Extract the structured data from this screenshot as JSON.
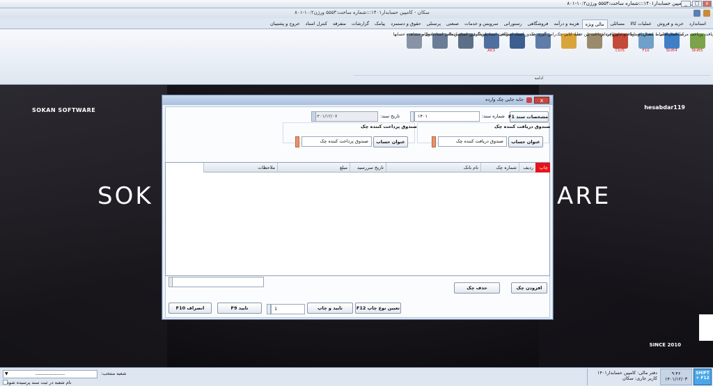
{
  "window": {
    "title": "سکان - کامپین حسابدار۱۴۰۱:::شماره ساخت:۵۵۵۴   ورژن۱۰:۲-۸۰۱",
    "subtitle": "سکان - کامپین حسابدار۱۴۰۱:::شماره ساخت:۵۵۵۴   ورژن۱۰:۲-۸۰۱"
  },
  "tabs": [
    {
      "label": "استاندارد",
      "active": false
    },
    {
      "label": "خرید و فروش",
      "active": false
    },
    {
      "label": "عملیات کالا",
      "active": false
    },
    {
      "label": "مسائلی",
      "active": false
    },
    {
      "label": "مالی ویژه",
      "active": true
    },
    {
      "label": "هزینه و درآمد",
      "active": false
    },
    {
      "label": "فروشگاهی",
      "active": false
    },
    {
      "label": "رستورانی",
      "active": false
    },
    {
      "label": "سرویس و خدمات",
      "active": false
    },
    {
      "label": "صنعتی",
      "active": false
    },
    {
      "label": "پرسنلی",
      "active": false
    },
    {
      "label": "حقوق و دستمزد",
      "active": false
    },
    {
      "label": "پیامک",
      "active": false
    },
    {
      "label": "گزارشات",
      "active": false
    },
    {
      "label": "متفرقه",
      "active": false
    },
    {
      "label": "کنترل اسناد",
      "active": false
    },
    {
      "label": "خروج و پشتیبان",
      "active": false
    }
  ],
  "ribbon": {
    "group_label": "ادامه",
    "buttons": [
      {
        "label": "دریافت پرداخت مرکب",
        "hotkey": "Shift5",
        "icon": "payment-icon"
      },
      {
        "label": "مبادلات داخلی",
        "hotkey": "Shift4",
        "icon": "exchange-icon"
      },
      {
        "label": "اعمال اقساط مشتری و دریافت قسط",
        "hotkey": "F10",
        "icon": "installment-icon"
      },
      {
        "label": "اعمال اقساط خودمان و پرداخت قسط",
        "hotkey": "Ctrl5",
        "icon": "installment-pay-icon"
      },
      {
        "label": "دریافت پرداخت بین حسابها",
        "hotkey": "",
        "icon": "bank-icon"
      },
      {
        "label": "جابه جایی چک",
        "hotkey": "",
        "icon": "check-move-icon"
      },
      {
        "label": "راس گیری چک",
        "hotkey": "",
        "icon": "calculator-icon"
      },
      {
        "label": "صدور اسناد انتظامی",
        "hotkey": "",
        "icon": "officer-icon"
      },
      {
        "label": "دریافت اسناد انتظامی",
        "hotkey": "Alt3",
        "icon": "officer-receive-icon"
      },
      {
        "label": "پس گرفتن اسناد انتظامی",
        "hotkey": "",
        "icon": "officer-back-icon"
      },
      {
        "label": "پس دادن اسناد انتظامی",
        "hotkey": "",
        "icon": "officer-return-icon"
      },
      {
        "label": "جدول و مشاهده حسابها",
        "hotkey": "",
        "icon": "search-table-icon"
      }
    ]
  },
  "background": {
    "brand_left": "SOKAN SOFTWARE",
    "brand_right": "hesabdar119",
    "big_left": "SOK",
    "big_right": "ARE",
    "since": "SINCE 2010"
  },
  "dialog": {
    "title": "جابه جایی چک وارده",
    "close": "x",
    "doc_spec_button": "مشخصات سند F1",
    "doc_number_label": "شماره سند:",
    "doc_number": "۱۴۰۱",
    "doc_date_label": "تاریخ سند:",
    "doc_date": "۱۴۰۱/۱۲/۰۷",
    "receiver_group": "صندوق دریافت کننده چک",
    "receiver_button": "عنوان حساب",
    "receiver_value": "صندوق دریافت کننده چک",
    "payer_group": "صندوق پرداخت کننده چک",
    "payer_button": "عنوان حساب",
    "payer_value": "صندوق پرداخت کننده چک",
    "grid_columns": [
      "چاپ",
      "ردیف",
      "شماره چک",
      "نام بانک",
      "تاریخ سررسید",
      "مبلغ",
      "ملاحظات"
    ],
    "add_check": "افزودن چک",
    "delete_check": "حذف چک",
    "bottom_select": "",
    "print_type": "تعیین نوع چاپ F12",
    "confirm_print": "تایید و چاپ",
    "copies": "1",
    "confirm": "تایید F9",
    "cancel": "انصراف F10"
  },
  "status": {
    "selected_branch_label": "شعبه منتخب:",
    "selected_branch_value": "------------------",
    "branch_checkbox_label": "نام شعبه در ثبت سند پرسیده شود",
    "fiscal_label": "دفتر مالی: کامپین حسابدار۱۴۰۱",
    "user_label": "کاربر جاری: سکان",
    "time": "۹:۴۶",
    "date": "۱۴۰۱/۱۲/۰۳",
    "shift_label": "SHIFT + F12"
  },
  "colors": {
    "accent_red": "#e8121b",
    "titlebar": "#dfe6ef",
    "shift_blue": "#4aa6e8"
  }
}
